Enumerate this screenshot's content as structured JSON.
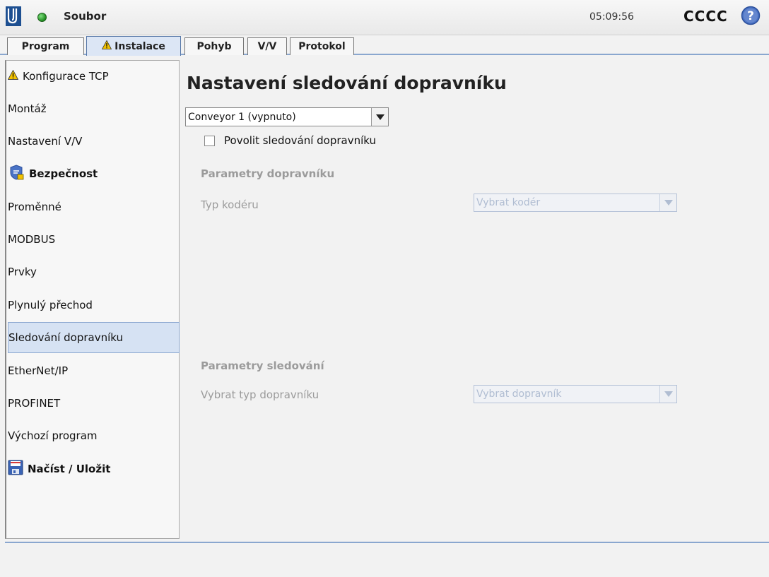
{
  "header": {
    "file_menu": "Soubor",
    "clock": "05:09:56",
    "robot_name": "CCCC"
  },
  "tabs": [
    {
      "label": "Program",
      "warning": false
    },
    {
      "label": "Instalace",
      "warning": true,
      "active": true
    },
    {
      "label": "Pohyb",
      "warning": false
    },
    {
      "label": "V/V",
      "warning": false
    },
    {
      "label": "Protokol",
      "warning": false
    }
  ],
  "sidebar": {
    "items": [
      {
        "label": "Konfigurace TCP",
        "icon": "warning-icon"
      },
      {
        "label": "Montáž"
      },
      {
        "label": "Nastavení V/V"
      },
      {
        "label": "Bezpečnost",
        "icon": "safety-shield-icon"
      },
      {
        "label": "Proměnné"
      },
      {
        "label": "MODBUS"
      },
      {
        "label": "Prvky"
      },
      {
        "label": "Plynulý přechod"
      },
      {
        "label": "Sledování dopravníku",
        "selected": true
      },
      {
        "label": "EtherNet/IP"
      },
      {
        "label": "PROFINET"
      },
      {
        "label": "Výchozí program"
      },
      {
        "label": "Načíst / Uložit",
        "icon": "floppy-disk-icon"
      }
    ]
  },
  "main": {
    "title": "Nastavení sledování dopravníku",
    "conveyor_select": "Conveyor 1 (vypnuto)",
    "enable_checkbox": {
      "label": "Povolit sledování dopravníku",
      "checked": false
    },
    "conveyor_params": {
      "heading": "Parametry dopravníku",
      "encoder_label": "Typ kodéru",
      "encoder_placeholder": "Vybrat kodér"
    },
    "tracking_params": {
      "heading": "Parametry sledování",
      "type_label": "Vybrat typ dopravníku",
      "type_placeholder": "Vybrat dopravník"
    }
  },
  "colors": {
    "accent_blue": "#8aa7cf",
    "selected_bg": "#d6e2f3",
    "status_green": "#2fa52f",
    "disabled_text": "#9b9b9b"
  }
}
